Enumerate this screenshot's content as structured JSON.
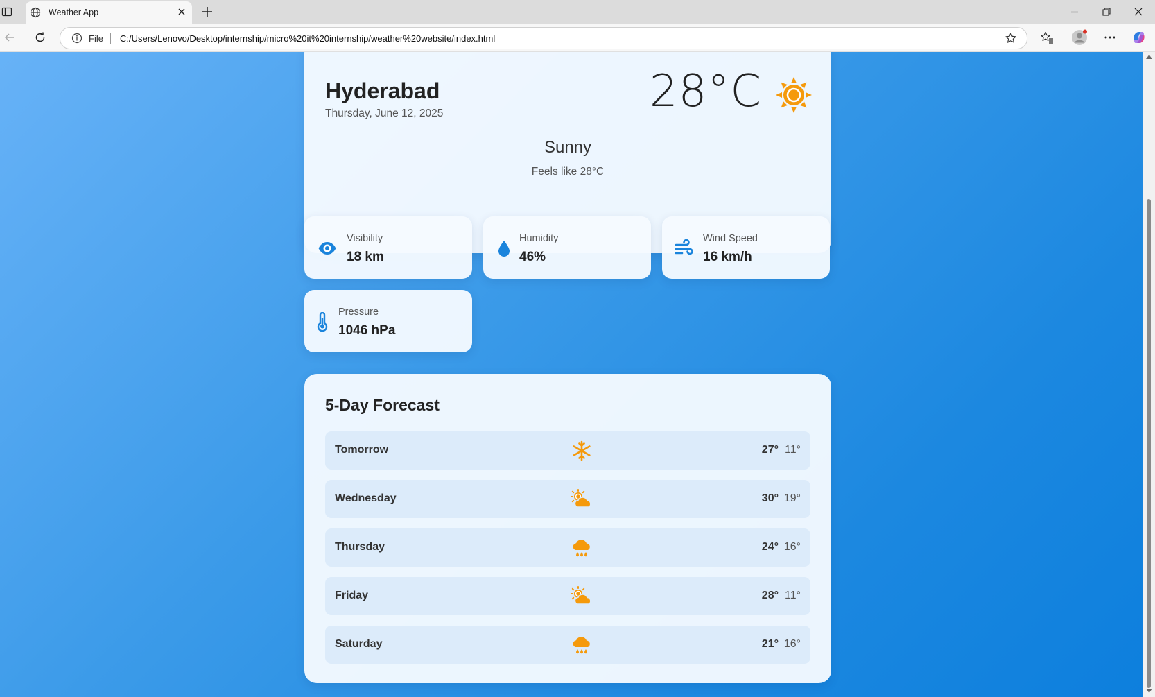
{
  "browser": {
    "tab_title": "Weather App",
    "address_prefix": "File",
    "url": "C:/Users/Lenovo/Desktop/internship/micro%20it%20internship/weather%20website/index.html"
  },
  "current": {
    "city": "Hyderabad",
    "date": "Thursday, June 12, 2025",
    "temperature": "28°C",
    "condition": "Sunny",
    "feels_like": "Feels like 28°C",
    "icon": "sun-icon"
  },
  "stats": [
    {
      "label": "Visibility",
      "value": "18 km",
      "icon": "eye-icon"
    },
    {
      "label": "Humidity",
      "value": "46%",
      "icon": "droplet-icon"
    },
    {
      "label": "Wind Speed",
      "value": "16 km/h",
      "icon": "wind-icon"
    },
    {
      "label": "Pressure",
      "value": "1046 hPa",
      "icon": "thermometer-icon"
    }
  ],
  "forecast": {
    "title": "5-Day Forecast",
    "days": [
      {
        "day": "Tomorrow",
        "high": "27°",
        "low": "11°",
        "icon": "snowflake-icon"
      },
      {
        "day": "Wednesday",
        "high": "30°",
        "low": "19°",
        "icon": "partly-cloudy-icon"
      },
      {
        "day": "Thursday",
        "high": "24°",
        "low": "16°",
        "icon": "rain-icon"
      },
      {
        "day": "Friday",
        "high": "28°",
        "low": "11°",
        "icon": "partly-cloudy-icon"
      },
      {
        "day": "Saturday",
        "high": "21°",
        "low": "16°",
        "icon": "rain-icon"
      }
    ]
  },
  "colors": {
    "accent": "#1a84dc",
    "icon_orange": "#f59a0c",
    "background_start": "#67b2f7",
    "background_end": "#0d7fdd"
  }
}
